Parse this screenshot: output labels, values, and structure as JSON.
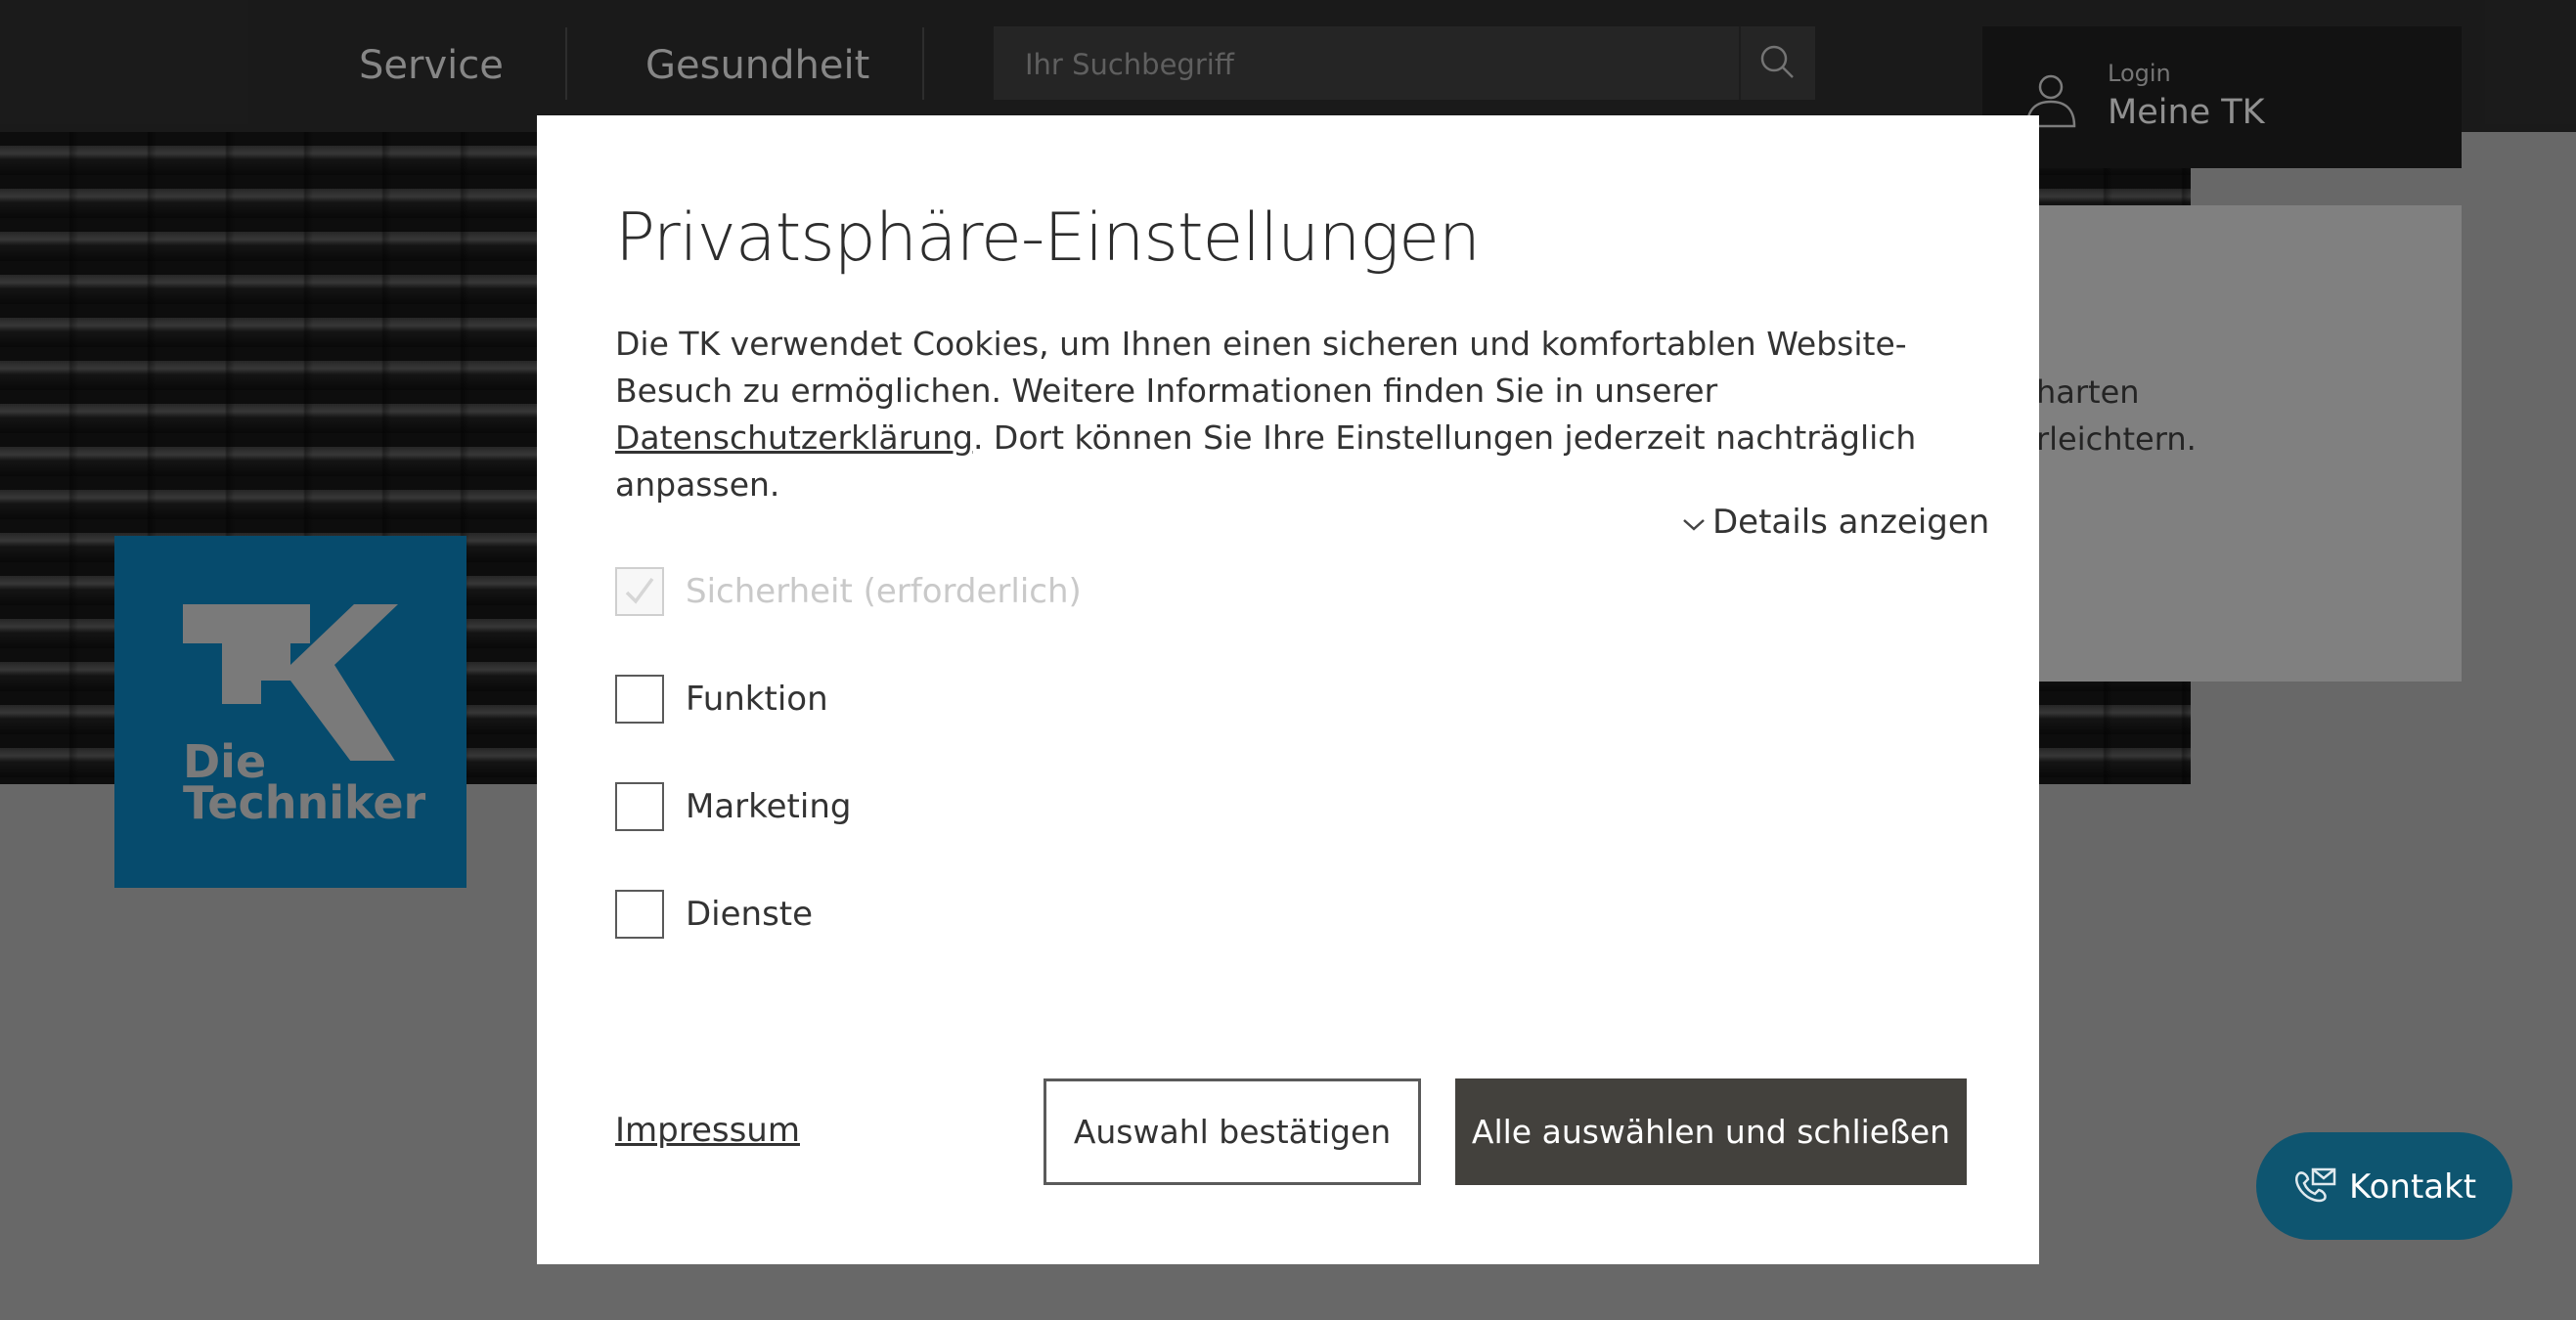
{
  "header": {
    "nav": [
      "Service",
      "Gesundheit"
    ],
    "search": {
      "placeholder": "Ihr Suchbegriff",
      "icon": "search-icon"
    },
    "login": {
      "small_label": "Login",
      "label": "Meine TK",
      "icon": "user-icon"
    }
  },
  "hero": {
    "card_lines": [
      "harten",
      "rleichtern."
    ]
  },
  "logo": {
    "line1": "Die",
    "line2": "Techniker"
  },
  "kontakt": {
    "label": "Kontakt",
    "icon": "phone-mail-icon"
  },
  "modal": {
    "title": "Privatsphäre-Einstellungen",
    "description_before_link": "Die TK verwendet Cookies, um Ihnen einen sicheren und komfortablen Website-Besuch zu ermöglichen. Weitere Informationen finden Sie in unserer ",
    "link_text": "Datenschutzerklärung",
    "description_after_link": ". Dort können Sie Ihre Einstellungen jederzeit nachträglich anpassen.",
    "details_label": "Details anzeigen",
    "options": [
      {
        "label": "Sicherheit (erforderlich)",
        "checked": true,
        "disabled": true
      },
      {
        "label": "Funktion",
        "checked": false,
        "disabled": false
      },
      {
        "label": "Marketing",
        "checked": false,
        "disabled": false
      },
      {
        "label": "Dienste",
        "checked": false,
        "disabled": false
      }
    ],
    "impressum_label": "Impressum",
    "confirm_label": "Auswahl bestätigen",
    "accept_all_label": "Alle auswählen und schließen"
  },
  "colors": {
    "brand_blue": "#0a7ab0",
    "dark_button": "#43413d",
    "kontakt_button": "#0e5570",
    "topbar": "#2b2b2b"
  }
}
